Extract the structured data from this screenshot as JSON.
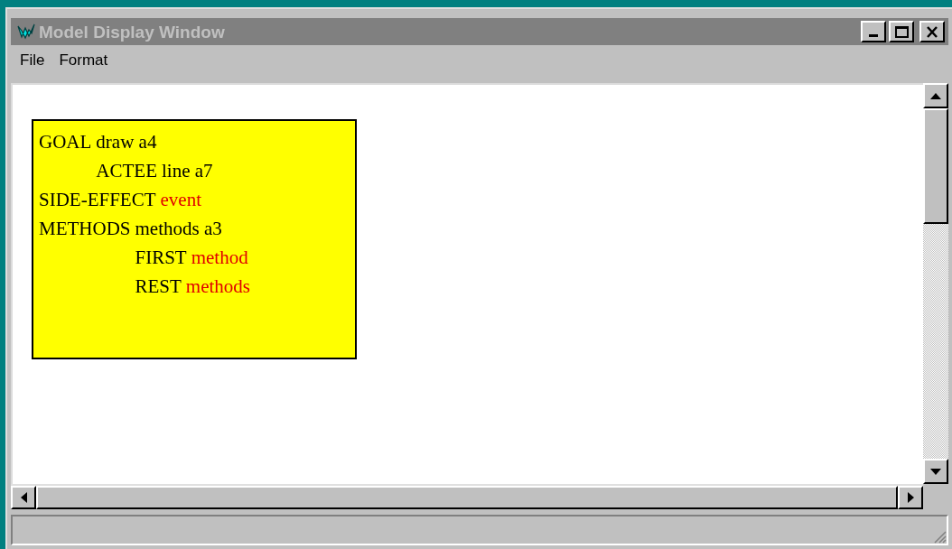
{
  "window": {
    "title": "Model Display Window"
  },
  "menu": [
    "File",
    "Format"
  ],
  "model_box": {
    "slots": [
      {
        "label": "GOAL",
        "value": "draw a4",
        "kind": "bound",
        "children": [
          {
            "label": "ACTEE",
            "value": "line a7",
            "kind": "bound"
          }
        ]
      },
      {
        "label": "SIDE-EFFECT",
        "value": "event",
        "kind": "unbound"
      },
      {
        "label": "METHODS",
        "value": "methods a3",
        "kind": "bound",
        "children": [
          {
            "label": "FIRST",
            "value": "method",
            "kind": "unbound"
          },
          {
            "label": "REST",
            "value": "methods",
            "kind": "unbound"
          }
        ]
      }
    ]
  }
}
